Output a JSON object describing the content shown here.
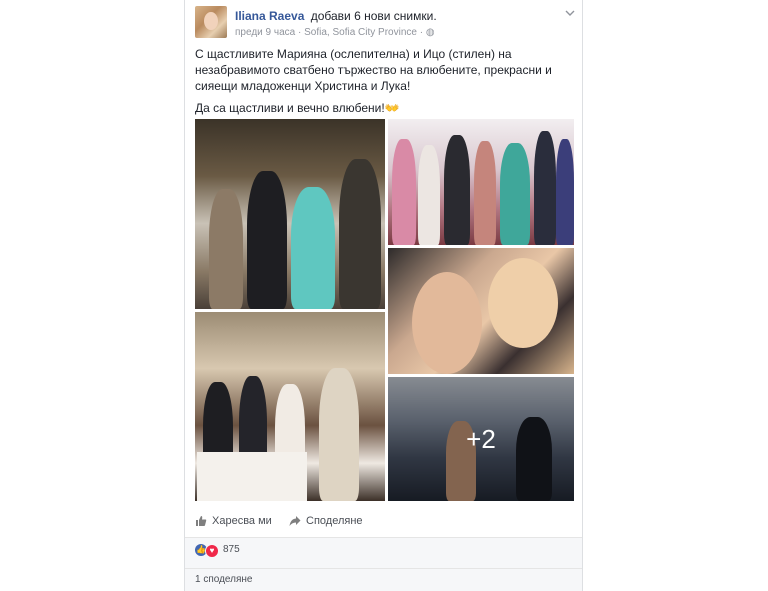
{
  "post": {
    "author": "Iliana Raeva",
    "action": "добави 6 нови снимки.",
    "time": "преди 9 часа",
    "separator": "·",
    "location": "Sofia, Sofia City Province",
    "privacy_glyph": "◍",
    "menu_icon": "chevron-down-icon",
    "text_paragraphs": [
      "С щастливите Марияна (ослепителна) и Ицо (стилен) на незабравимото сватбено тържество на влюбените, прекрасни и сияещи младоженци Христина и Лука!",
      "Да са щастливи и вечно влюбени!👐"
    ],
    "photos_overlay": "+2"
  },
  "actions": {
    "like_label": "Харесва ми",
    "share_label": "Споделяне"
  },
  "reactions": {
    "count": "875",
    "like_glyph": "👍",
    "love_glyph": "♥"
  },
  "shares": {
    "label": "1 споделяне"
  },
  "colors": {
    "link": "#365899",
    "like": "#4267b2",
    "love": "#f0284a"
  }
}
